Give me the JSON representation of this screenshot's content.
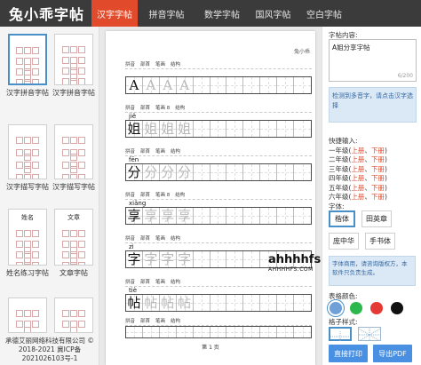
{
  "header": {
    "logo": "兔小乖字帖",
    "tabs": [
      "汉字字帖",
      "拼音字帖",
      "数学字帖",
      "国风字帖",
      "空白字帖"
    ],
    "active_tab": 0
  },
  "left_panel": {
    "thumbs": [
      {
        "label": "汉字拼音字帖",
        "selected": true
      },
      {
        "label": "汉字拼音字帖",
        "selected": false
      },
      {
        "label": "汉字描写字帖",
        "selected": false
      },
      {
        "label": "汉字描写字帖",
        "selected": false
      },
      {
        "label": "姓名练习字帖",
        "selected": false
      },
      {
        "label": "文章字帖",
        "selected": false
      }
    ],
    "thumb_text": {
      "name_card": "姓名",
      "article": "文章"
    },
    "footer_line1": "承德艾丽网络科技有限公司 ©",
    "footer_line2": "2018-2021 冀ICP备",
    "footer_line3": "2021026103号-1"
  },
  "preview": {
    "header_text": "兔小乖",
    "head_labels": [
      "拼音",
      "部首",
      "笔画",
      "结构"
    ],
    "rows": [
      {
        "pinyin": "",
        "char": "A",
        "traces": [
          "A",
          "A",
          "A"
        ],
        "stroke_label": "笔画"
      },
      {
        "pinyin": "jiě",
        "char": "姐",
        "traces": [
          "姐",
          "姐",
          "姐"
        ],
        "stroke_label": "笔画 8"
      },
      {
        "pinyin": "fēn",
        "char": "分",
        "traces": [
          "分",
          "分",
          "分"
        ],
        "stroke_label": "笔画"
      },
      {
        "pinyin": "xiǎng",
        "char": "享",
        "traces": [
          "享",
          "享",
          "享"
        ],
        "stroke_label": "笔画 8"
      },
      {
        "pinyin": "zì",
        "char": "字",
        "traces": [
          "字",
          "字",
          "字"
        ],
        "stroke_label": "笔画"
      },
      {
        "pinyin": "tiè",
        "char": "帖",
        "traces": [
          "帖",
          "帖",
          "帖"
        ],
        "stroke_label": "笔画"
      }
    ],
    "page_label": "第 1 页"
  },
  "right_panel": {
    "content_label": "字帖内容:",
    "content_value": "A姐分享字帖",
    "counter": "6/200",
    "notice1": "检测到多音字，请点击汉字选择",
    "quick_label": "快捷输入:",
    "grades": [
      {
        "name": "一年级",
        "up": "上册",
        "down": "下册"
      },
      {
        "name": "二年级",
        "up": "上册",
        "down": "下册"
      },
      {
        "name": "三年级",
        "up": "上册",
        "down": "下册"
      },
      {
        "name": "四年级",
        "up": "上册",
        "down": "下册"
      },
      {
        "name": "五年级",
        "up": "上册",
        "down": "下册"
      },
      {
        "name": "六年级",
        "up": "上册",
        "down": "下册"
      }
    ],
    "font_label": "字体:",
    "fonts": [
      {
        "label": "楷体",
        "selected": true
      },
      {
        "label": "田英章",
        "selected": false
      },
      {
        "label": "庞中华",
        "selected": false
      },
      {
        "label": "手书体",
        "selected": false
      }
    ],
    "notice2": "字体商用，请咨询版权方，本软件只负责生成。",
    "color_label": "表格颜色:",
    "colors": [
      {
        "hex": "#6fa0d8",
        "selected": true
      },
      {
        "hex": "#2db84d",
        "selected": false
      },
      {
        "hex": "#e53935",
        "selected": false
      },
      {
        "hex": "#111111",
        "selected": false
      }
    ],
    "grid_label": "格子样式:",
    "print_button": "直接打印",
    "pdf_button": "导出PDF"
  },
  "watermark": {
    "main": "ahhhhfs",
    "sub": "AHHHHFS.COM"
  }
}
